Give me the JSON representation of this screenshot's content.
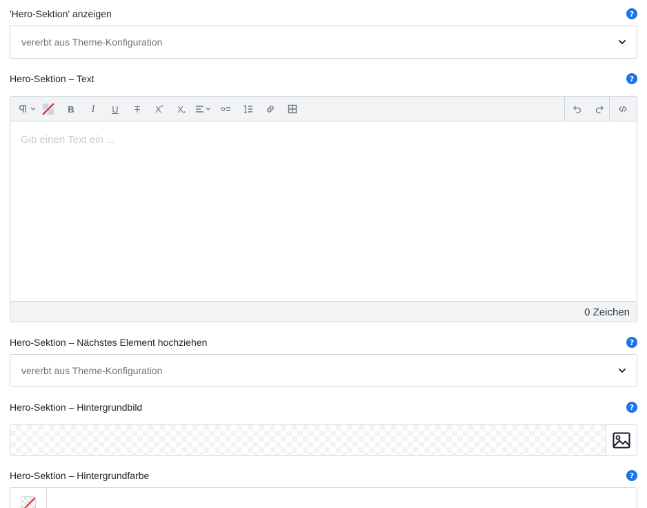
{
  "fields": {
    "show_hero": {
      "label": "'Hero-Sektion' anzeigen",
      "value": "vererbt aus Theme-Konfiguration",
      "help": "?"
    },
    "hero_text": {
      "label": "Hero-Sektion – Text",
      "help": "?",
      "placeholder": "Gib einen Text ein ...",
      "char_count": "0 Zeichen"
    },
    "pull_next": {
      "label": "Hero-Sektion – Nächstes Element hochziehen",
      "value": "vererbt aus Theme-Konfiguration",
      "help": "?"
    },
    "bg_image": {
      "label": "Hero-Sektion – Hintergrundbild",
      "help": "?"
    },
    "bg_color": {
      "label": "Hero-Sektion – Hintergrundfarbe",
      "help": "?",
      "value": ""
    }
  },
  "toolbar": {
    "buttons": [
      "paragraph-format",
      "remove-format",
      "bold",
      "italic",
      "underline",
      "strikethrough",
      "superscript",
      "subscript",
      "align",
      "bullet-list",
      "numbered-list",
      "link",
      "table",
      "undo",
      "redo",
      "code-view"
    ],
    "bold_glyph": "B",
    "italic_glyph": "I",
    "underline_glyph": "U",
    "strike_glyph": "T",
    "superscript_glyph": "X",
    "subscript_glyph": "X"
  },
  "colors": {
    "accent": "#1a73e8",
    "border": "#d1d5db",
    "toolbar_bg": "#f1f3f5"
  }
}
